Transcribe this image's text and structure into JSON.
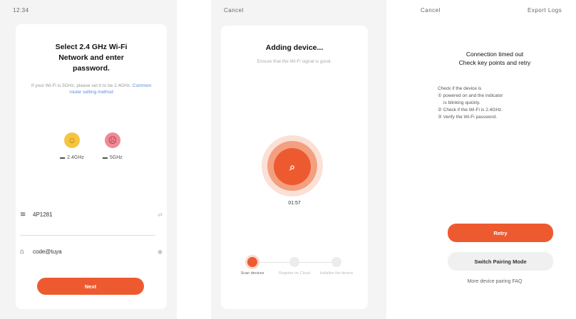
{
  "screen1": {
    "status": "12:34",
    "title": "Select 2.4 GHz Wi-Fi Network and enter password.",
    "hint": "If your Wi-Fi is 5GHz, please set it to be 2.4GHz.",
    "hint_link": "Common router setting method",
    "band_good": "2.4GHz",
    "band_bad": "5GHz",
    "wifi_name": "4P1281",
    "password": "code@tuya",
    "next_label": "Next"
  },
  "screen2": {
    "status": "Cancel",
    "title": "Adding device...",
    "subtitle": "Ensure that the Wi-Fi signal is good.",
    "progress_text": "01:57",
    "steps": [
      "Scan devices",
      "Register on Cloud",
      "Initialize the device"
    ],
    "accent": "#ee5a30"
  },
  "screen3": {
    "status_left": "Cancel",
    "status_right": "Export Logs",
    "title_line1": "Connection timed out",
    "title_line2": "Check key points and retry",
    "checks": [
      "Check if the device is",
      "① powered on and the indicator",
      "is blinking quickly.",
      "② Check if the Wi-Fi is 2.4GHz.",
      "③ Verify the Wi-Fi password."
    ],
    "retry_label": "Retry",
    "switch_label": "Switch Pairing Mode",
    "footer": "More device pairing FAQ"
  }
}
